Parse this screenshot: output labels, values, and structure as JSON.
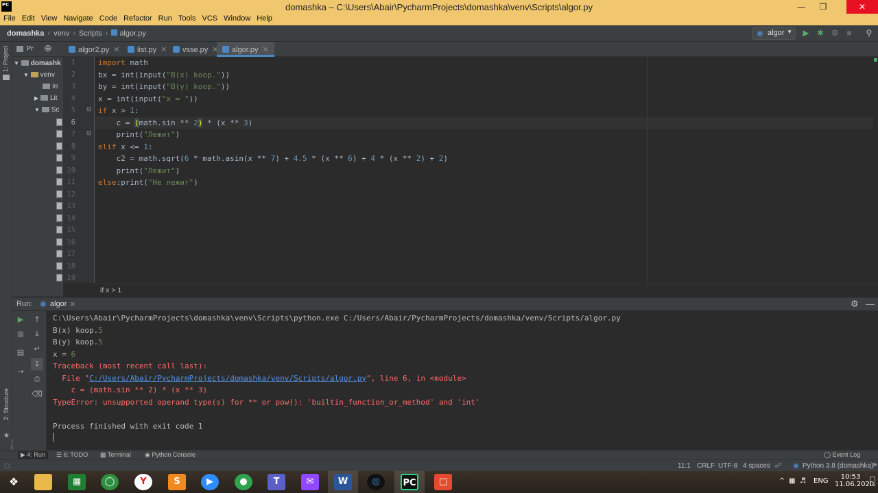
{
  "window": {
    "title": "domashka – C:\\Users\\Abair\\PycharmProjects\\domashka\\venv\\Scripts\\algor.py",
    "logo": "PC"
  },
  "menu": [
    "File",
    "Edit",
    "View",
    "Navigate",
    "Code",
    "Refactor",
    "Run",
    "Tools",
    "VCS",
    "Window",
    "Help"
  ],
  "breadcrumb": {
    "project": "domashka",
    "venv": "venv",
    "scripts": "Scripts",
    "file": "algor.py"
  },
  "run_config": "algor",
  "project_panel": {
    "label": "Pr",
    "root": "domashk",
    "venv": "venv",
    "include": "In",
    "lib": "Lit",
    "scripts": "Sc",
    "side_tab": "1: Project"
  },
  "tabs": [
    {
      "label": "algor2.py"
    },
    {
      "label": "list.py"
    },
    {
      "label": "vsse.py"
    },
    {
      "label": "algor.py"
    }
  ],
  "editor": {
    "line_numbers": [
      "1",
      "2",
      "3",
      "4",
      "5",
      "6",
      "7",
      "8",
      "9",
      "10",
      "11",
      "12",
      "13",
      "14",
      "15",
      "16",
      "17",
      "18",
      "19"
    ],
    "breadcrumb": "if x > 1"
  },
  "run_panel": {
    "label": "Run:",
    "tab": "algor"
  },
  "console": {
    "cmd": "C:\\Users\\Abair\\PycharmProjects\\domashka\\venv\\Scripts\\python.exe C:/Users/Abair/PycharmProjects/domashka/venv/Scripts/algor.py",
    "bx_prompt": "B(x) koop.",
    "bx_val": "5",
    "by_prompt": "B(y) koop.",
    "by_val": "5",
    "x_prompt": "x = ",
    "x_val": "6",
    "tb1": "Traceback (most recent call last):",
    "tb2_pre": "  File \"",
    "tb2_link": "C:/Users/Abair/PycharmProjects/domashka/venv/Scripts/algor.py",
    "tb2_post": "\", line 6, in <module>",
    "tb3": "    c = (math.sin ** 2) * (x ** 3)",
    "tb4": "TypeError: unsupported operand type(s) for ** or pow(): 'builtin_function_or_method' and 'int'",
    "exit": "Process finished with exit code 1"
  },
  "left_tabs": {
    "structure": "2: Structure",
    "favorites": "2: Favorites"
  },
  "bottom_tabs": {
    "run": "4: Run",
    "todo": "6: TODO",
    "terminal": "Terminal",
    "console": "Python Console",
    "event_log": "Event Log"
  },
  "status": {
    "pos": "11:1",
    "eol": "CRLF",
    "enc": "UTF-8",
    "indent": "4 spaces",
    "interp": "Python 3.8 (domashka)"
  },
  "tray": {
    "lang": "ENG",
    "time": "10:53",
    "date": "11.06.2020"
  }
}
